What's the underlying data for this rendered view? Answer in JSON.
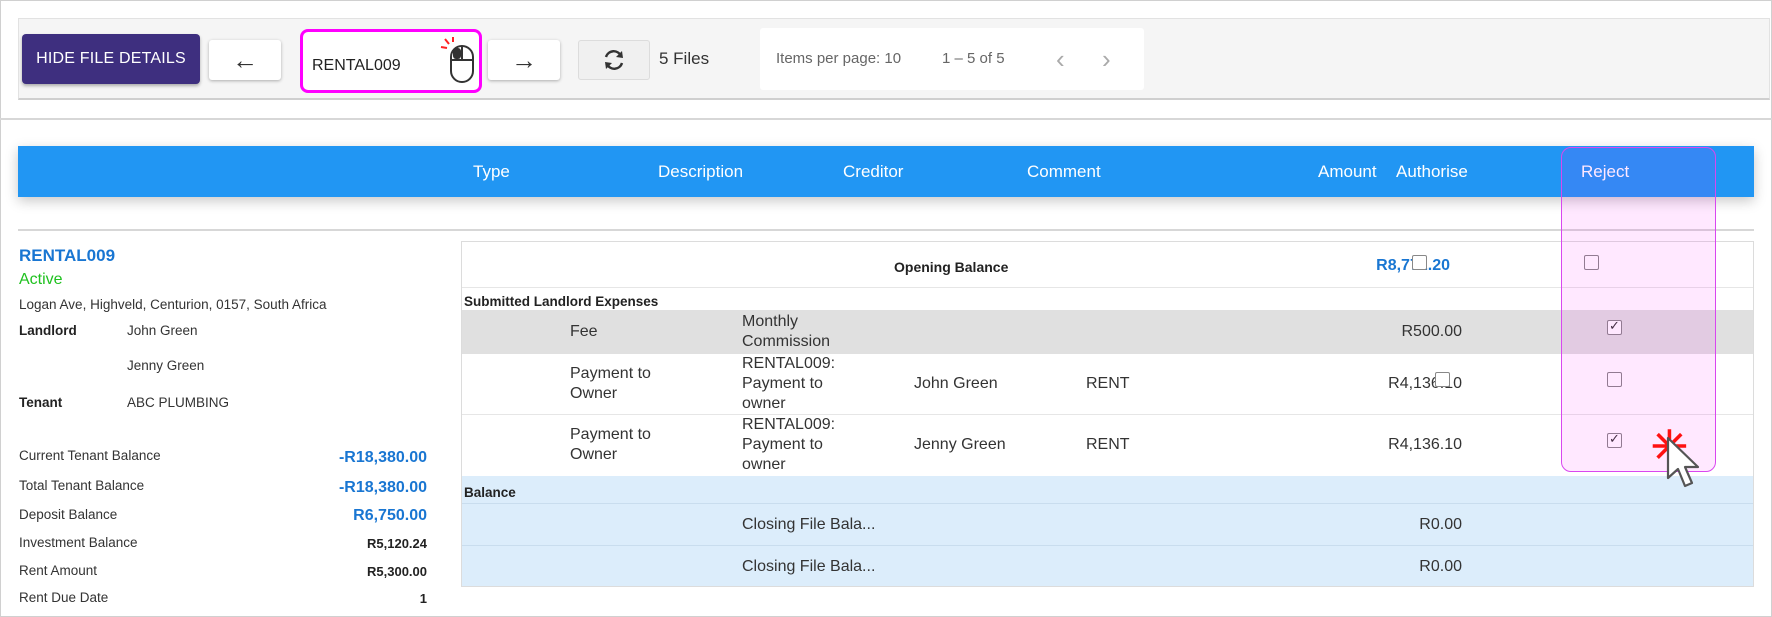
{
  "toolbar": {
    "hide_details_label": "HIDE FILE DETAILS",
    "prev_label": "←",
    "next_label": "→",
    "file_input_value": "RENTAL009",
    "files_count": "5 Files",
    "items_per_page": "Items per page: 10",
    "page_range": "1 – 5 of 5"
  },
  "columns": [
    "Type",
    "Description",
    "Creditor",
    "Comment",
    "Amount",
    "Authorise",
    "Reject"
  ],
  "property": {
    "id": "RENTAL009",
    "status": "Active",
    "address": "Logan Ave, Highveld, Centurion, 0157, South Africa",
    "landlord_label": "Landlord",
    "landlords": [
      "John Green",
      "Jenny Green"
    ],
    "tenant_label": "Tenant",
    "tenant": "ABC PLUMBING"
  },
  "balances": [
    {
      "label": "Current Tenant Balance",
      "value": "-R18,380.00"
    },
    {
      "label": "Total Tenant Balance",
      "value": "-R18,380.00"
    },
    {
      "label": "Deposit Balance",
      "value": "R6,750.00"
    },
    {
      "label": "Investment Balance",
      "value": "R5,120.24"
    },
    {
      "label": "Rent Amount",
      "value": "R5,300.00"
    },
    {
      "label": "Rent Due Date",
      "value": "1"
    }
  ],
  "table": {
    "opening_label": "Opening Balance",
    "opening_amount": "R8,772.20",
    "section_expenses": "Submitted Landlord Expenses",
    "rows": [
      {
        "type": "Fee",
        "description": "Monthly Commission",
        "creditor": "",
        "comment": "",
        "amount": "R500.00",
        "authorise": null,
        "reject": true
      },
      {
        "type": "Payment to Owner",
        "description": "RENTAL009: Payment to owner",
        "creditor": "John Green",
        "comment": "RENT",
        "amount": "R4,136.10",
        "authorise": false,
        "reject": false
      },
      {
        "type": "Payment to Owner",
        "description": "RENTAL009: Payment to owner",
        "creditor": "Jenny Green",
        "comment": "RENT",
        "amount": "R4,136.10",
        "authorise": null,
        "reject": true
      }
    ],
    "section_balance": "Balance",
    "closing_rows": [
      {
        "description": "Closing File Bala...",
        "amount": "R0.00"
      },
      {
        "description": "Closing File Bala...",
        "amount": "R0.00"
      }
    ]
  },
  "colors": {
    "primary_button": "#3e2f7f",
    "header_bar": "#2196f3",
    "highlight": "#ff00ff",
    "active_status": "#1fc11f",
    "link_blue": "#1976d2"
  }
}
